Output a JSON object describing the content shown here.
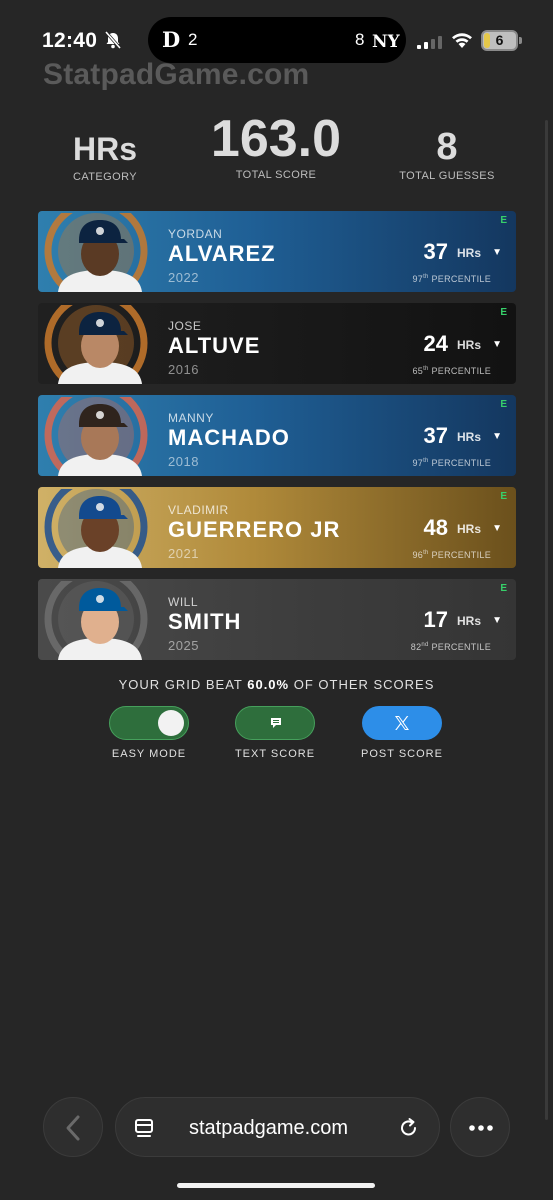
{
  "status_bar": {
    "time": "12:40",
    "away_team_logo": "D",
    "away_score": "2",
    "home_score": "8",
    "home_team_logo": "NY",
    "battery": "6"
  },
  "site": {
    "logo": "StatpadGame.com"
  },
  "summary_stats": {
    "category_value": "HRs",
    "category_label": "CATEGORY",
    "total_score_value": "163.0",
    "total_score_label": "TOTAL SCORE",
    "guesses_value": "8",
    "guesses_label": "TOTAL GUESSES"
  },
  "players": [
    {
      "first": "YORDAN",
      "last": "ALVAREZ",
      "year": "2022",
      "hrs": "37",
      "unit": "HRs",
      "pct_num": "97",
      "pct_suffix": "th",
      "pct_word": "PERCENTILE",
      "badge": "E",
      "team": "Astros",
      "theme": "blue",
      "badge_color": "#c9792b",
      "cap_color": "#0c2340",
      "skin": "#5a3a24"
    },
    {
      "first": "JOSE",
      "last": "ALTUVE",
      "year": "2016",
      "hrs": "24",
      "unit": "HRs",
      "pct_num": "65",
      "pct_suffix": "th",
      "pct_word": "PERCENTILE",
      "badge": "E",
      "team": "Astros",
      "theme": "black",
      "badge_color": "#c9792b",
      "cap_color": "#0c2340",
      "skin": "#b98866"
    },
    {
      "first": "MANNY",
      "last": "MACHADO",
      "year": "2018",
      "hrs": "37",
      "unit": "HRs",
      "pct_num": "97",
      "pct_suffix": "th",
      "pct_word": "PERCENTILE",
      "badge": "E",
      "team": "Marlins",
      "theme": "blue",
      "badge_color": "#d9664f",
      "cap_color": "#2f241d",
      "skin": "#a87858"
    },
    {
      "first": "VLADIMIR",
      "last": "GUERRERO JR",
      "year": "2021",
      "hrs": "48",
      "unit": "HRs",
      "pct_num": "96",
      "pct_suffix": "th",
      "pct_word": "PERCENTILE",
      "badge": "E",
      "team": "Blue Jays",
      "theme": "gold",
      "badge_color": "#1d4f91",
      "cap_color": "#134a8e",
      "skin": "#6a4128"
    },
    {
      "first": "WILL",
      "last": "SMITH",
      "year": "2025",
      "hrs": "17",
      "unit": "HRs",
      "pct_num": "82",
      "pct_suffix": "nd",
      "pct_word": "PERCENTILE",
      "badge": "E",
      "team": "Dodgers",
      "theme": "gray",
      "badge_color": "#6d6d6d",
      "cap_color": "#005a9c",
      "skin": "#e0b08e"
    }
  ],
  "result": {
    "prefix": "YOUR GRID BEAT ",
    "percent": "60.0%",
    "suffix": " OF OTHER SCORES"
  },
  "actions": {
    "easy_mode": "EASY MODE",
    "text_score": "TEXT SCORE",
    "post_score": "POST SCORE"
  },
  "browser": {
    "url": "statpadgame.com"
  }
}
